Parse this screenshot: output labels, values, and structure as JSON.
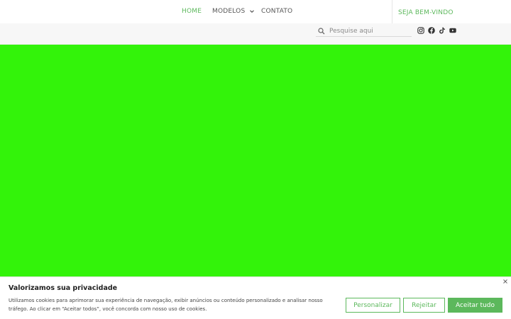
{
  "nav": {
    "items": [
      {
        "label": "HOME",
        "active": true
      },
      {
        "label": "MODELOS",
        "active": false
      },
      {
        "label": "CONTATO",
        "active": false
      }
    ],
    "welcome": "SEJA BEM-VINDO"
  },
  "search": {
    "placeholder": "Pesquise aqui",
    "value": ""
  },
  "socials": [
    "instagram-icon",
    "facebook-icon",
    "tiktok-icon",
    "youtube-icon"
  ],
  "colors": {
    "accent": "#5cb85c",
    "hero": "#33f30a"
  },
  "cookie": {
    "title": "Valorizamos sua privacidade",
    "text": "Utilizamos cookies para aprimorar sua experiência de navegação, exibir anúncios ou conteúdo personalizado e analisar nosso tráfego. Ao clicar em “Aceitar todos”, você concorda com nosso uso de cookies.",
    "customize_label": "Personalizar",
    "reject_label": "Rejeitar",
    "accept_label": "Aceitar tudo"
  }
}
